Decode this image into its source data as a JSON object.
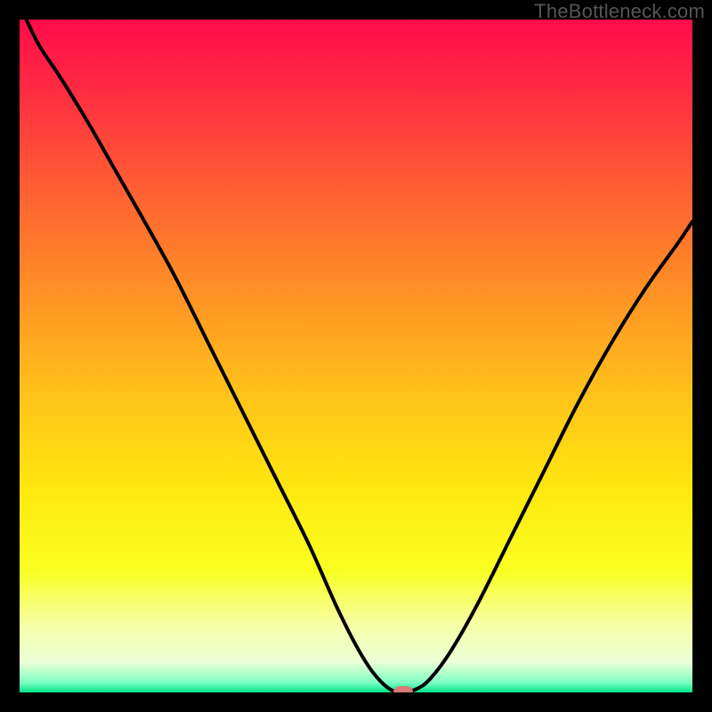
{
  "watermark": "TheBottleneck.com",
  "chart_data": {
    "type": "line",
    "title": "",
    "xlabel": "",
    "ylabel": "",
    "xlim": [
      0,
      100
    ],
    "ylim": [
      0,
      100
    ],
    "grid": false,
    "legend": false,
    "background": {
      "type": "vertical-gradient",
      "stops": [
        {
          "pos": 0.0,
          "color": "#ff0b4a"
        },
        {
          "pos": 0.1,
          "color": "#ff2a42"
        },
        {
          "pos": 0.25,
          "color": "#ff5e33"
        },
        {
          "pos": 0.4,
          "color": "#ff8f26"
        },
        {
          "pos": 0.55,
          "color": "#ffc01a"
        },
        {
          "pos": 0.7,
          "color": "#ffe80f"
        },
        {
          "pos": 0.82,
          "color": "#f9ff22"
        },
        {
          "pos": 0.9,
          "color": "#f6ffa8"
        },
        {
          "pos": 0.955,
          "color": "#eaffd6"
        },
        {
          "pos": 0.985,
          "color": "#7fffc4"
        },
        {
          "pos": 1.0,
          "color": "#00e589"
        }
      ]
    },
    "series": [
      {
        "name": "bottleneck-curve",
        "color": "#000000",
        "x": [
          1,
          3,
          6,
          10,
          14,
          18,
          23,
          28,
          33,
          38,
          43,
          47,
          50,
          52.5,
          55,
          57,
          59,
          61,
          64,
          68,
          73,
          78,
          83,
          88,
          93,
          98,
          100
        ],
        "y": [
          100,
          96,
          91.5,
          85,
          78,
          71,
          62,
          52,
          42,
          32,
          22,
          13,
          7,
          3,
          0.5,
          0,
          0.5,
          2,
          6,
          13,
          23,
          33,
          43,
          52,
          60,
          67,
          70
        ]
      }
    ],
    "marker": {
      "x": 57,
      "y": 0,
      "color": "#d97a7a"
    }
  }
}
